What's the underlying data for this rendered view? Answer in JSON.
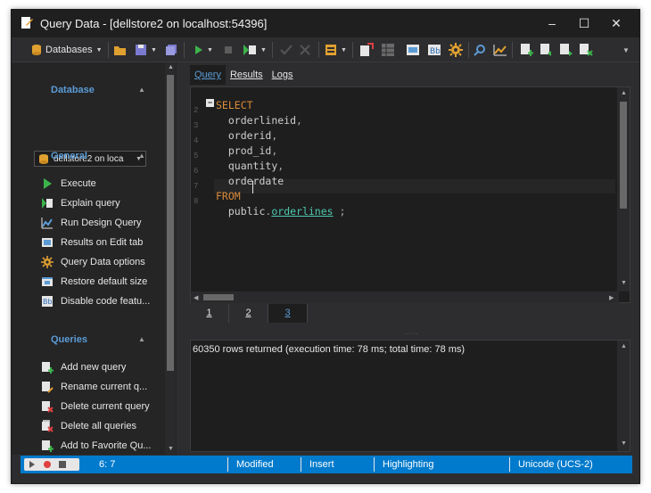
{
  "window": {
    "title": "Query Data - [dellstore2 on localhost:54396]",
    "minimize_glyph": "–",
    "maximize_glyph": "☐",
    "close_glyph": "✕"
  },
  "toolbar": {
    "database_label": "Databases"
  },
  "sidebar": {
    "database_section": {
      "title": "Database",
      "selected_db": "dellstore2 on loca"
    },
    "general_section": {
      "title": "General",
      "items": [
        {
          "label": "Execute",
          "icon": "execute-icon"
        },
        {
          "label": "Explain query",
          "icon": "explain-icon"
        },
        {
          "label": "Run Design Query",
          "icon": "design-query-icon"
        },
        {
          "label": "Results on Edit tab",
          "icon": "results-tab-icon"
        },
        {
          "label": "Query Data options",
          "icon": "options-icon"
        },
        {
          "label": "Restore default size",
          "icon": "restore-size-icon"
        },
        {
          "label": "Disable code featu...",
          "icon": "code-features-icon"
        }
      ]
    },
    "queries_section": {
      "title": "Queries",
      "items": [
        {
          "label": "Add new query",
          "icon": "add-query-icon"
        },
        {
          "label": "Rename current q...",
          "icon": "rename-query-icon"
        },
        {
          "label": "Delete current query",
          "icon": "delete-query-icon"
        },
        {
          "label": "Delete all queries",
          "icon": "delete-all-icon"
        },
        {
          "label": "Add to Favorite Qu...",
          "icon": "favorite-icon"
        }
      ]
    }
  },
  "tabs": [
    {
      "label": "Query",
      "active": true
    },
    {
      "label": "Results",
      "active": false
    },
    {
      "label": "Logs",
      "active": false
    }
  ],
  "editor": {
    "line_numbers": [
      "2",
      "3",
      "4",
      "5",
      "6",
      "7",
      "8"
    ],
    "lines": [
      {
        "keyword": "SELECT"
      },
      {
        "ident": "orderlineid",
        "punct": ","
      },
      {
        "ident": "orderid",
        "punct": ","
      },
      {
        "ident": "prod_id",
        "punct": ","
      },
      {
        "ident": "quantity",
        "punct": ","
      },
      {
        "ident": "orderdate"
      },
      {
        "keyword": "FROM"
      },
      {
        "schema": "public",
        "dot": ".",
        "table": "orderlines",
        "punct": ";"
      }
    ],
    "fold_glyph": "−"
  },
  "page_tabs": [
    {
      "label": "1",
      "active": false
    },
    {
      "label": "2",
      "active": false
    },
    {
      "label": "3",
      "active": true
    }
  ],
  "messages": {
    "text": "60350 rows returned (execution time: 78 ms; total time: 78 ms)"
  },
  "statusbar": {
    "position": "6:   7",
    "modified": "Modified",
    "insert": "Insert",
    "highlighting": "Highlighting",
    "encoding": "Unicode (UCS-2)"
  },
  "colors": {
    "accent": "#5b9bd5",
    "statusbar": "#007acc",
    "keyword": "#d98c3a",
    "table": "#4ec9b0"
  }
}
